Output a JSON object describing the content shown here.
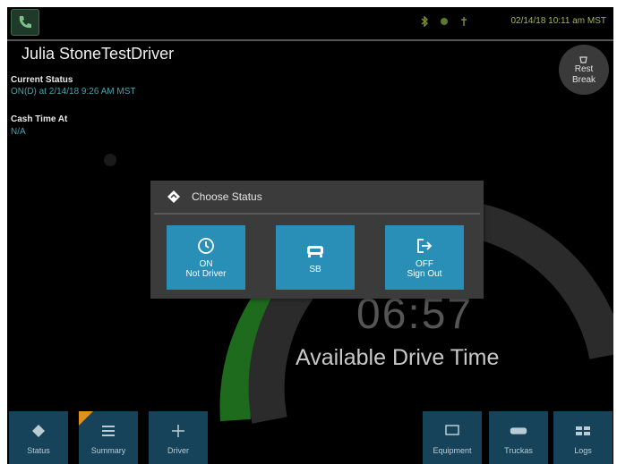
{
  "status_bar": {
    "datetime": "02/14/18 10:11 am MST"
  },
  "driver": {
    "name": "Julia StoneTestDriver"
  },
  "current_status": {
    "label": "Current Status",
    "value": "ON(D) at 2/14/18 9:26 AM MST"
  },
  "cycle": {
    "label": "Cash Time At",
    "value": "N/A"
  },
  "rest_break": {
    "line1": "Rest",
    "line2": "Break"
  },
  "gauge": {
    "time": "06:57",
    "label": "Available Drive Time",
    "colors": {
      "ring": "#1e6b1e",
      "track": "#2b2b2b"
    }
  },
  "dialog": {
    "title": "Choose Status",
    "buttons": [
      {
        "line1": "ON",
        "line2": "Not Driver",
        "icon": "clock-icon"
      },
      {
        "line1": "SB",
        "line2": "",
        "icon": "sleeper-icon"
      },
      {
        "line1": "OFF",
        "line2": "Sign Out",
        "icon": "sign-out-icon"
      }
    ]
  },
  "bottom_nav": [
    {
      "label": "Status",
      "icon": "diamond-icon"
    },
    {
      "label": "Summary",
      "icon": "list-icon"
    },
    {
      "label": "Driver",
      "icon": "plus-icon"
    },
    {
      "label": "Equipment",
      "icon": "monitor-icon"
    },
    {
      "label": "Truckas",
      "icon": "truck-icon"
    },
    {
      "label": "Logs",
      "icon": "grid-icon"
    }
  ],
  "colors": {
    "accent": "#2a8fb7",
    "nav_bg": "#16435a",
    "status_value": "#4aa3ad",
    "datetime": "#a7b64a"
  }
}
